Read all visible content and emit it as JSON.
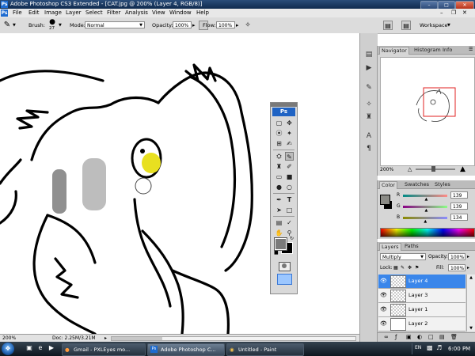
{
  "window": {
    "app_icon": "Ps",
    "title": "Adobe Photoshop CS3 Extended - [CAT.jpg @ 200% (Layer 4, RGB/8)]",
    "controls": [
      "minimize-icon",
      "maximize-icon",
      "close-icon"
    ]
  },
  "menubar": {
    "icon": "Ps",
    "items": [
      "File",
      "Edit",
      "Image",
      "Layer",
      "Select",
      "Filter",
      "Analysis",
      "View",
      "Window",
      "Help"
    ]
  },
  "options": {
    "brush_label": "Brush:",
    "brush_size": "27",
    "mode_label": "Mode:",
    "mode_value": "Normal",
    "opacity_label": "Opacity:",
    "opacity_value": "100%",
    "flow_label": "Flow:",
    "flow_value": "100%",
    "workspace_label": "Workspace"
  },
  "toolbox": {
    "badge": "Ps",
    "tools": [
      "move-icon",
      "marquee-icon",
      "lasso-icon",
      "magic-wand-icon",
      "crop-icon",
      "slice-icon",
      "healing-icon",
      "brush-icon",
      "clone-stamp-icon",
      "history-brush-icon",
      "eraser-icon",
      "gradient-icon",
      "blur-icon",
      "dodge-icon",
      "pen-icon",
      "type-icon",
      "path-select-icon",
      "shape-icon",
      "notes-icon",
      "eyedropper-icon",
      "hand-icon",
      "zoom-icon"
    ],
    "foreground_color": "#7a7a7a",
    "background_color": "#000000"
  },
  "navigator": {
    "tabs": [
      "Navigator",
      "Histogram",
      "Info"
    ],
    "zoom": "200%",
    "view_box_color": "#e02020"
  },
  "color_panel": {
    "tabs": [
      "Color",
      "Swatches",
      "Styles"
    ],
    "channels": [
      {
        "label": "R",
        "value": "139",
        "level": 0.545
      },
      {
        "label": "G",
        "value": "139",
        "level": 0.545
      },
      {
        "label": "B",
        "value": "134",
        "level": 0.525
      }
    ]
  },
  "layers_panel": {
    "tabs": [
      "Layers",
      "Paths"
    ],
    "blend_mode": "Multiply",
    "opacity_label": "Opacity:",
    "opacity_value": "100%",
    "lock_label": "Lock:",
    "fill_label": "Fill:",
    "fill_value": "100%",
    "layers": [
      {
        "name": "Layer 4",
        "selected": true
      },
      {
        "name": "Layer 3",
        "selected": false
      },
      {
        "name": "Layer 1",
        "selected": false
      },
      {
        "name": "Layer 2",
        "selected": false
      }
    ]
  },
  "status": {
    "zoom": "200%",
    "doc": "Doc: 2.25M/3.21M"
  },
  "taskbar": {
    "start": "start-orb",
    "tasks": [
      {
        "label": "Gmail - PXLEyes mo...",
        "icon": "firefox-icon",
        "active": false
      },
      {
        "label": "Adobe Photoshop C...",
        "icon": "photoshop-icon",
        "active": true
      },
      {
        "label": "Untitled - Paint",
        "icon": "paint-icon",
        "active": false
      }
    ],
    "tray_label": "EN",
    "time": "6:00 PM"
  }
}
